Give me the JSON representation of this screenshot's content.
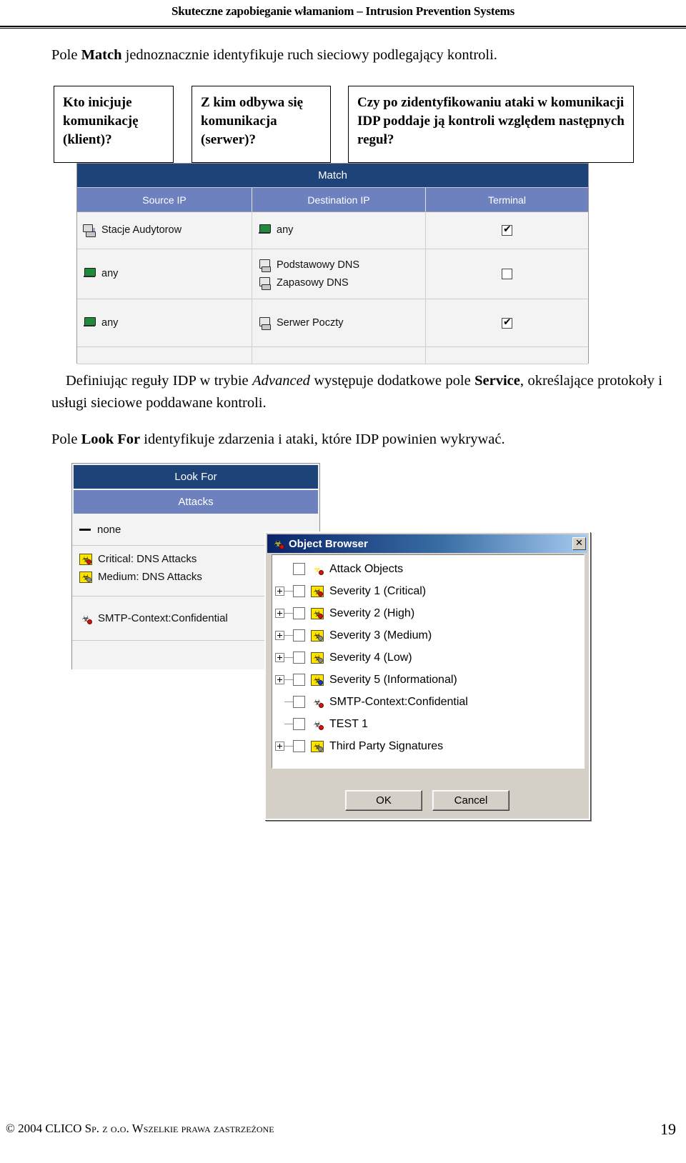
{
  "header": {
    "running_head": "Skuteczne zapobieganie włamaniom – Intrusion Prevention Systems"
  },
  "paragraphs": {
    "match_intro_pre": "Pole ",
    "match_intro_bold": "Match",
    "match_intro_post": " jednoznacznie identyfikuje ruch sieciowy podlegający kontroli.",
    "advanced_pre": "Definiując reguły IDP w trybie ",
    "advanced_italic": "Advanced",
    "advanced_mid": " występuje dodatkowe pole ",
    "advanced_bold": "Service",
    "advanced_post": ", określające protokoły i usługi sieciowe poddawane kontroli.",
    "lookfor_pre": "Pole ",
    "lookfor_bold": "Look For",
    "lookfor_post": " identyfikuje zdarzenia i ataki, które IDP powinien wykrywać."
  },
  "callouts": [
    {
      "id": "callout-1",
      "text": "Kto inicjuje komunikację (klient)?"
    },
    {
      "id": "callout-2",
      "text": "Z kim odbywa się komunikacja (serwer)?"
    },
    {
      "id": "callout-3",
      "text": "Czy po zidentyfikowaniu ataki w komunikacji IDP poddaje ją kontroli względem następnych reguł?"
    }
  ],
  "match_table": {
    "title": "Match",
    "columns": [
      "Source IP",
      "Destination IP",
      "Terminal"
    ],
    "rows": [
      {
        "source": [
          {
            "label": "Stacje Audytorow",
            "icon": "host-group-icon"
          }
        ],
        "destination": [
          {
            "label": "any",
            "icon": "network-icon"
          }
        ],
        "terminal": true
      },
      {
        "source": [
          {
            "label": "any",
            "icon": "network-icon"
          }
        ],
        "destination": [
          {
            "label": "Podstawowy DNS",
            "icon": "host-icon"
          },
          {
            "label": "Zapasowy DNS",
            "icon": "host-icon"
          }
        ],
        "terminal": false
      },
      {
        "source": [
          {
            "label": "any",
            "icon": "network-icon"
          }
        ],
        "destination": [
          {
            "label": "Serwer Poczty",
            "icon": "host-icon"
          }
        ],
        "terminal": true
      }
    ],
    "colors": {
      "title_bar": "#1d4378",
      "column_header": "#6d81bf",
      "row_bg": "#f3f3f3"
    }
  },
  "look_for_panel": {
    "title": "Look For",
    "subtitle": "Attacks",
    "groups": [
      {
        "items": [
          {
            "label": "none",
            "icon": "dash-icon"
          }
        ]
      },
      {
        "items": [
          {
            "label": "Critical: DNS Attacks",
            "icon": "attack-severity-icon"
          },
          {
            "label": "Medium: DNS Attacks",
            "icon": "attack-severity-icon"
          }
        ]
      },
      {
        "items": [
          {
            "label": "SMTP-Context:Confidential",
            "icon": "attack-object-icon"
          }
        ]
      }
    ],
    "colors": {
      "title_bar": "#1d4378",
      "subtitle_bar": "#6d81bf"
    }
  },
  "object_browser": {
    "title": "Object Browser",
    "title_icon": "attack-object-icon",
    "close_icon": "close-icon",
    "tree": [
      {
        "label": "Attack Objects",
        "icon": "attack-objects-icon",
        "expandable": false,
        "checked": false,
        "level": 0
      },
      {
        "label": "Severity 1 (Critical)",
        "icon": "attack-severity-icon",
        "expandable": true,
        "checked": false,
        "level": 1,
        "dot": "red"
      },
      {
        "label": "Severity 2 (High)",
        "icon": "attack-severity-icon",
        "expandable": true,
        "checked": false,
        "level": 1,
        "dot": "red"
      },
      {
        "label": "Severity 3 (Medium)",
        "icon": "attack-severity-icon",
        "expandable": true,
        "checked": false,
        "level": 1,
        "dot": "gray"
      },
      {
        "label": "Severity 4 (Low)",
        "icon": "attack-severity-icon",
        "expandable": true,
        "checked": false,
        "level": 1,
        "dot": "gray"
      },
      {
        "label": "Severity 5 (Informational)",
        "icon": "attack-severity-icon",
        "expandable": true,
        "checked": false,
        "level": 1,
        "dot": "blue"
      },
      {
        "label": "SMTP-Context:Confidential",
        "icon": "attack-object-icon",
        "expandable": false,
        "checked": false,
        "level": 1,
        "dot": "red"
      },
      {
        "label": "TEST 1",
        "icon": "attack-object-icon",
        "expandable": false,
        "checked": false,
        "level": 1,
        "dot": "red"
      },
      {
        "label": "Third Party Signatures",
        "icon": "attack-severity-icon",
        "expandable": true,
        "checked": false,
        "level": 1,
        "dot": "gray"
      }
    ],
    "buttons": {
      "ok": "OK",
      "cancel": "Cancel"
    }
  },
  "footer": {
    "copyright": "© 2004 CLICO Sp. z o.o. Wszelkie prawa zastrzeżone",
    "page_number": "19"
  }
}
